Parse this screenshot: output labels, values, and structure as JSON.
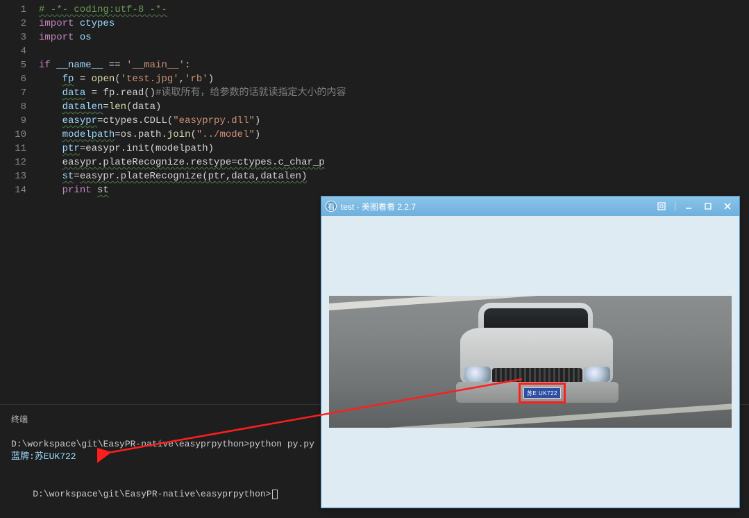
{
  "editor": {
    "lines": [
      {
        "n": 1,
        "html": "<span class='cmt wavy'># -*- coding:utf-8 -*-</span>"
      },
      {
        "n": 2,
        "html": "<span class='kw'>import</span> <span class='name'>ctypes</span>"
      },
      {
        "n": 3,
        "html": "<span class='kw'>import</span> <span class='name'>os</span>"
      },
      {
        "n": 4,
        "html": ""
      },
      {
        "n": 5,
        "html": "<span class='kw'>if</span> <span class='name'>__name__</span> <span class='eq'>==</span> <span class='str'>'__main__'</span>:"
      },
      {
        "n": 6,
        "html": "    <span class='name wavy'>fp</span> = <span class='fn'>open</span>(<span class='str'>'test.jpg'</span>,<span class='str'>'rb'</span>)"
      },
      {
        "n": 7,
        "html": "    <span class='name wavy'>data</span> = fp.read()<span class='cmt2'>#读取所有，给参数的话就读指定大小的内容</span>"
      },
      {
        "n": 8,
        "html": "    <span class='name wavy'>datalen</span>=<span class='fn'>len</span>(data)"
      },
      {
        "n": 9,
        "html": "    <span class='name wavy'>easypr</span>=ctypes.CDLL(<span class='str'>\"easyprpy.dll\"</span>)"
      },
      {
        "n": 10,
        "html": "    <span class='name wavy'>modelpath</span>=os.path.<span class='fn'>join</span>(<span class='str'>\"../model\"</span>)"
      },
      {
        "n": 11,
        "html": "    <span class='name wavy'>ptr</span>=easypr.init(modelpath)"
      },
      {
        "n": 12,
        "html": "    <span class='wavy'>easypr.plateRecognize.restype=ctypes.c_char_p</span>"
      },
      {
        "n": 13,
        "html": "    <span class='name wavy'>st</span>=<span class='wavy'>easypr.plateRecognize(ptr,data,datalen)</span>"
      },
      {
        "n": 14,
        "html": "    <span class='kw'>print</span> <span class='wavy'>st</span>"
      }
    ]
  },
  "terminal": {
    "label": "终端",
    "line1": "D:\\workspace\\git\\EasyPR-native\\easyprpython>python py.py",
    "line2": "蓝牌:苏EUK722",
    "line3_prefix": "D:\\workspace\\git\\EasyPR-native\\easyprpython>"
  },
  "viewer": {
    "title": "test - 美图看看 2.2.7",
    "plate_text": "苏E UK722"
  }
}
